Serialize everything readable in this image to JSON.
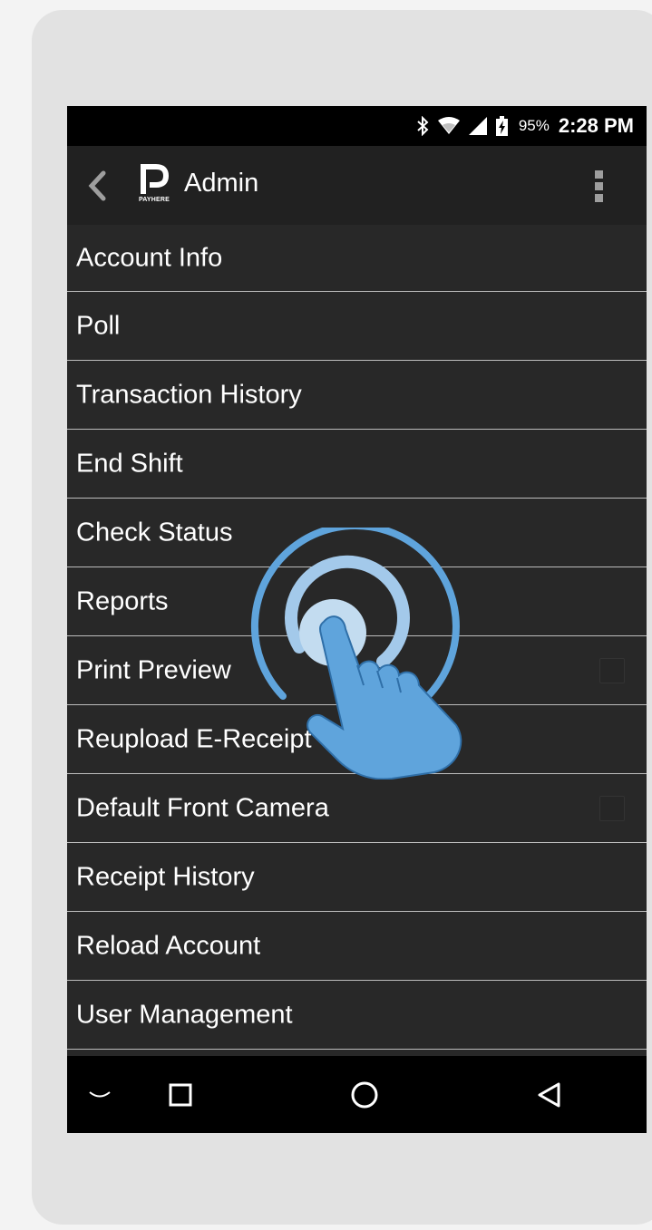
{
  "status_bar": {
    "battery_percent": "95%",
    "time": "2:28 PM",
    "icons": [
      "bluetooth-icon",
      "wifi-icon",
      "cell-signal-icon",
      "battery-charging-icon"
    ]
  },
  "action_bar": {
    "logo_text": "PAYHERE",
    "title": "Admin",
    "icons": [
      "back-arrow-icon",
      "overflow-menu-icon"
    ]
  },
  "menu": {
    "items": [
      {
        "label": "Account Info"
      },
      {
        "label": "Poll"
      },
      {
        "label": "Transaction History"
      },
      {
        "label": "End Shift"
      },
      {
        "label": "Check Status"
      },
      {
        "label": "Reports"
      },
      {
        "label": "Print Preview",
        "checkbox": false
      },
      {
        "label": "Reupload E-Receipt"
      },
      {
        "label": "Default Front Camera",
        "checkbox": false
      },
      {
        "label": "Receipt History"
      },
      {
        "label": "Reload Account"
      },
      {
        "label": "User Management"
      }
    ]
  },
  "nav_bar": {
    "icons": [
      "hide-keyboard-icon",
      "recents-square-icon",
      "home-circle-icon",
      "back-triangle-icon"
    ]
  },
  "colors": {
    "screen_bg": "#282828",
    "action_bar_bg": "#212121",
    "divider": "#bdbdbd",
    "tap_accent": "#5fa4dc"
  }
}
